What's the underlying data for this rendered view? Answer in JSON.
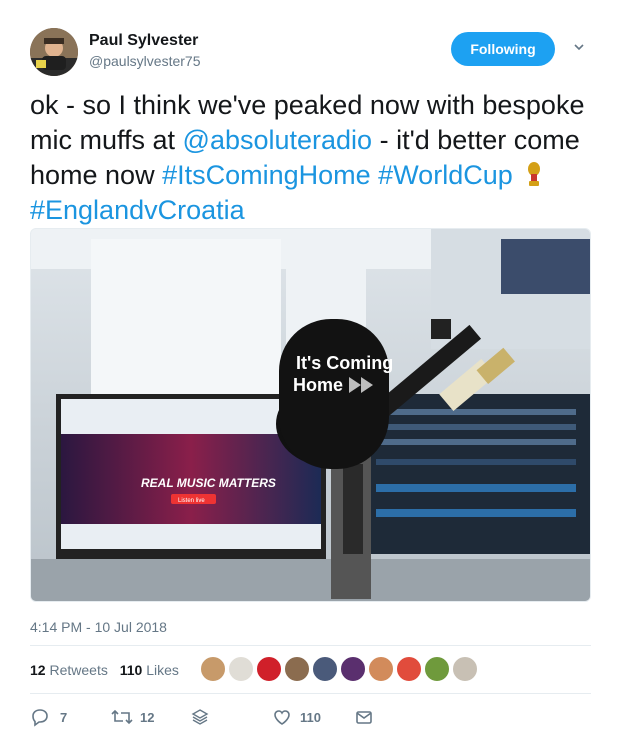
{
  "author": {
    "name": "Paul Sylvester",
    "handle": "@paulsylvester75"
  },
  "follow_button": {
    "label": "Following"
  },
  "tweet": {
    "text_1": "ok - so I think we've peaked now with bespoke mic muffs at ",
    "mention": "@absoluteradio",
    "text_2": " - it'd better come home now ",
    "hashtag_1": "#ItsComingHome",
    "hashtag_2": "#WorldCup",
    "hashtag_3": "#EnglandvCroatia"
  },
  "photo": {
    "muff_line1": "It's Coming",
    "muff_line2": "Home",
    "screen_text": "REAL MUSIC MATTERS",
    "screen_button": "Listen live"
  },
  "timestamp": "4:14 PM - 10 Jul 2018",
  "stats": {
    "retweets_count": "12",
    "retweets_label": "Retweets",
    "likes_count": "110",
    "likes_label": "Likes"
  },
  "actions": {
    "reply_count": "7",
    "retweet_count": "12",
    "like_count": "110"
  },
  "colors": {
    "accent": "#1da1f2",
    "link": "#1b95e0",
    "muted": "#657786"
  }
}
